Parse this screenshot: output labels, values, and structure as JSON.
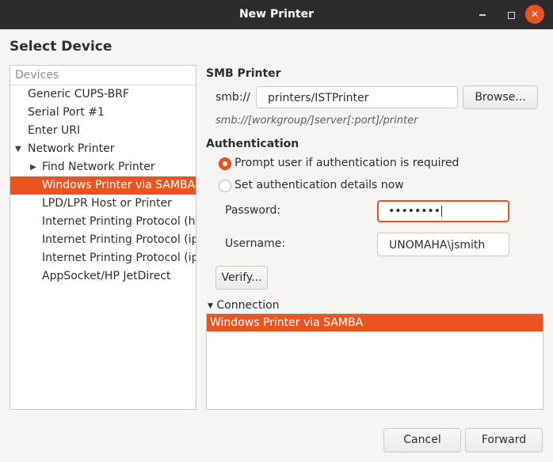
{
  "window": {
    "title": "New Printer",
    "close_glyph": "✕"
  },
  "heading": "Select Device",
  "devices": {
    "header": "Devices",
    "items": [
      {
        "label": "Generic CUPS-BRF"
      },
      {
        "label": "Serial Port #1"
      },
      {
        "label": "Enter URI"
      },
      {
        "label": "Network Printer"
      },
      {
        "label": "Find Network Printer"
      },
      {
        "label": "Windows Printer via SAMBA"
      },
      {
        "label": "LPD/LPR Host or Printer"
      },
      {
        "label": "Internet Printing Protocol (ht"
      },
      {
        "label": "Internet Printing Protocol (ip"
      },
      {
        "label": "Internet Printing Protocol (ip"
      },
      {
        "label": "AppSocket/HP JetDirect"
      }
    ],
    "selected": "Windows Printer via SAMBA"
  },
  "smb": {
    "section_label": "SMB Printer",
    "prefix": "smb://",
    "path_value": "printers/ISTPrinter",
    "browse_label": "Browse...",
    "hint": "smb://[workgroup/]server[:port]/printer"
  },
  "auth": {
    "section_label": "Authentication",
    "option_prompt": "Prompt user if authentication is required",
    "option_set": "Set authentication details now",
    "selected_option": "Prompt user if authentication is required",
    "password_label": "Password:",
    "password_value": "••••••••",
    "username_label": "Username:",
    "username_value": "UNOMAHA\\jsmith",
    "verify_label": "Verify..."
  },
  "connection": {
    "label": "Connection",
    "rows": [
      "Windows Printer via SAMBA"
    ]
  },
  "footer": {
    "cancel_label": "Cancel",
    "forward_label": "Forward"
  },
  "colors": {
    "accent": "#e95420",
    "titlebar": "#2c2c2c",
    "background": "#f6f5f4"
  },
  "icons": {
    "minimize": "minimize-icon",
    "maximize": "maximize-icon",
    "close": "close-icon",
    "expanded": "triangle-down-icon",
    "collapsed": "triangle-right-icon"
  }
}
